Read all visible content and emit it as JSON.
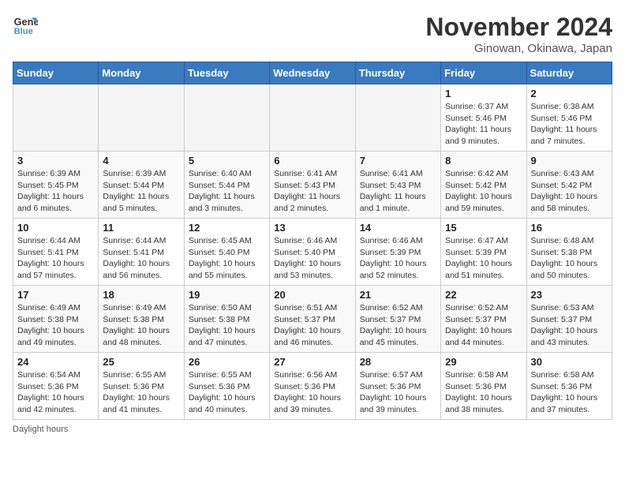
{
  "logo": {
    "line1": "General",
    "line2": "Blue"
  },
  "title": "November 2024",
  "location": "Ginowan, Okinawa, Japan",
  "days_of_week": [
    "Sunday",
    "Monday",
    "Tuesday",
    "Wednesday",
    "Thursday",
    "Friday",
    "Saturday"
  ],
  "footer": "Daylight hours",
  "weeks": [
    [
      {
        "day": "",
        "info": ""
      },
      {
        "day": "",
        "info": ""
      },
      {
        "day": "",
        "info": ""
      },
      {
        "day": "",
        "info": ""
      },
      {
        "day": "",
        "info": ""
      },
      {
        "day": "1",
        "info": "Sunrise: 6:37 AM\nSunset: 5:46 PM\nDaylight: 11 hours and 9 minutes."
      },
      {
        "day": "2",
        "info": "Sunrise: 6:38 AM\nSunset: 5:46 PM\nDaylight: 11 hours and 7 minutes."
      }
    ],
    [
      {
        "day": "3",
        "info": "Sunrise: 6:39 AM\nSunset: 5:45 PM\nDaylight: 11 hours and 6 minutes."
      },
      {
        "day": "4",
        "info": "Sunrise: 6:39 AM\nSunset: 5:44 PM\nDaylight: 11 hours and 5 minutes."
      },
      {
        "day": "5",
        "info": "Sunrise: 6:40 AM\nSunset: 5:44 PM\nDaylight: 11 hours and 3 minutes."
      },
      {
        "day": "6",
        "info": "Sunrise: 6:41 AM\nSunset: 5:43 PM\nDaylight: 11 hours and 2 minutes."
      },
      {
        "day": "7",
        "info": "Sunrise: 6:41 AM\nSunset: 5:43 PM\nDaylight: 11 hours and 1 minute."
      },
      {
        "day": "8",
        "info": "Sunrise: 6:42 AM\nSunset: 5:42 PM\nDaylight: 10 hours and 59 minutes."
      },
      {
        "day": "9",
        "info": "Sunrise: 6:43 AM\nSunset: 5:42 PM\nDaylight: 10 hours and 58 minutes."
      }
    ],
    [
      {
        "day": "10",
        "info": "Sunrise: 6:44 AM\nSunset: 5:41 PM\nDaylight: 10 hours and 57 minutes."
      },
      {
        "day": "11",
        "info": "Sunrise: 6:44 AM\nSunset: 5:41 PM\nDaylight: 10 hours and 56 minutes."
      },
      {
        "day": "12",
        "info": "Sunrise: 6:45 AM\nSunset: 5:40 PM\nDaylight: 10 hours and 55 minutes."
      },
      {
        "day": "13",
        "info": "Sunrise: 6:46 AM\nSunset: 5:40 PM\nDaylight: 10 hours and 53 minutes."
      },
      {
        "day": "14",
        "info": "Sunrise: 6:46 AM\nSunset: 5:39 PM\nDaylight: 10 hours and 52 minutes."
      },
      {
        "day": "15",
        "info": "Sunrise: 6:47 AM\nSunset: 5:39 PM\nDaylight: 10 hours and 51 minutes."
      },
      {
        "day": "16",
        "info": "Sunrise: 6:48 AM\nSunset: 5:38 PM\nDaylight: 10 hours and 50 minutes."
      }
    ],
    [
      {
        "day": "17",
        "info": "Sunrise: 6:49 AM\nSunset: 5:38 PM\nDaylight: 10 hours and 49 minutes."
      },
      {
        "day": "18",
        "info": "Sunrise: 6:49 AM\nSunset: 5:38 PM\nDaylight: 10 hours and 48 minutes."
      },
      {
        "day": "19",
        "info": "Sunrise: 6:50 AM\nSunset: 5:38 PM\nDaylight: 10 hours and 47 minutes."
      },
      {
        "day": "20",
        "info": "Sunrise: 6:51 AM\nSunset: 5:37 PM\nDaylight: 10 hours and 46 minutes."
      },
      {
        "day": "21",
        "info": "Sunrise: 6:52 AM\nSunset: 5:37 PM\nDaylight: 10 hours and 45 minutes."
      },
      {
        "day": "22",
        "info": "Sunrise: 6:52 AM\nSunset: 5:37 PM\nDaylight: 10 hours and 44 minutes."
      },
      {
        "day": "23",
        "info": "Sunrise: 6:53 AM\nSunset: 5:37 PM\nDaylight: 10 hours and 43 minutes."
      }
    ],
    [
      {
        "day": "24",
        "info": "Sunrise: 6:54 AM\nSunset: 5:36 PM\nDaylight: 10 hours and 42 minutes."
      },
      {
        "day": "25",
        "info": "Sunrise: 6:55 AM\nSunset: 5:36 PM\nDaylight: 10 hours and 41 minutes."
      },
      {
        "day": "26",
        "info": "Sunrise: 6:55 AM\nSunset: 5:36 PM\nDaylight: 10 hours and 40 minutes."
      },
      {
        "day": "27",
        "info": "Sunrise: 6:56 AM\nSunset: 5:36 PM\nDaylight: 10 hours and 39 minutes."
      },
      {
        "day": "28",
        "info": "Sunrise: 6:57 AM\nSunset: 5:36 PM\nDaylight: 10 hours and 39 minutes."
      },
      {
        "day": "29",
        "info": "Sunrise: 6:58 AM\nSunset: 5:36 PM\nDaylight: 10 hours and 38 minutes."
      },
      {
        "day": "30",
        "info": "Sunrise: 6:58 AM\nSunset: 5:36 PM\nDaylight: 10 hours and 37 minutes."
      }
    ]
  ]
}
